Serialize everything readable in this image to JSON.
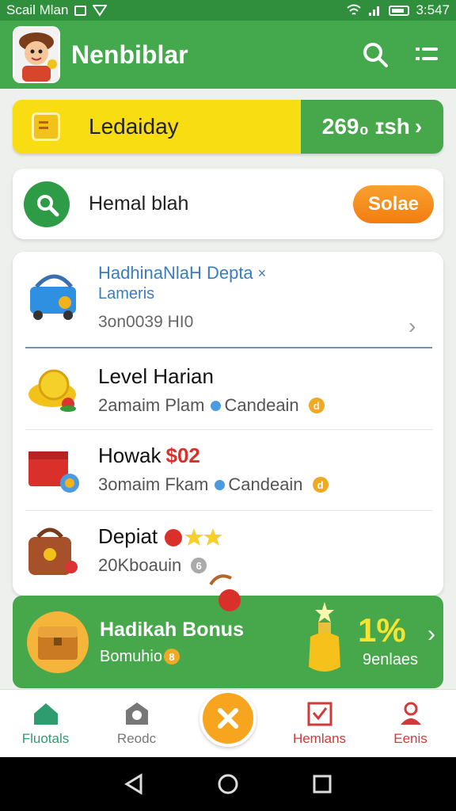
{
  "status_bar": {
    "left_text": "Scail Mlan",
    "time": "3:547"
  },
  "app_bar": {
    "title": "Nenbiblar"
  },
  "daily": {
    "label": "Ledaiday",
    "action": "269₀ ɪsh"
  },
  "search": {
    "placeholder": "Hemal blah",
    "button": "Solae"
  },
  "list": [
    {
      "title": "HadhinaNlaH Depta",
      "title_suffix": "×",
      "subtitle": "Lameris",
      "meta": "3on0039 HI0",
      "chevron": "›"
    },
    {
      "title": "Level Harian",
      "sub_main": "2amaim Plam",
      "sub_tag": "Candeain",
      "coin": "d"
    },
    {
      "title": "Howak",
      "title_amount": "$02",
      "sub_main": "3omaim Fkam",
      "sub_tag": "Candeain",
      "coin": "d"
    },
    {
      "title": "Depiat",
      "sub_main": "20Kboauin",
      "coin": "6"
    }
  ],
  "bonus": {
    "title": "Hadikah Bonus",
    "sub": "Bomuhio",
    "coin": "8",
    "percent": "1%",
    "percent_sub": "9enlaes"
  },
  "bottom_nav": [
    {
      "label": "Fluotals",
      "color": "#2e9c6e"
    },
    {
      "label": "Reodc",
      "color": "#777777"
    },
    {
      "label": "Hemlans",
      "color": "#d23a3a"
    },
    {
      "label": "Eenis",
      "color": "#d23a3a"
    }
  ],
  "colors": {
    "primary": "#44a84c",
    "accent_yellow": "#f7dd12",
    "accent_orange": "#f7a41e"
  }
}
